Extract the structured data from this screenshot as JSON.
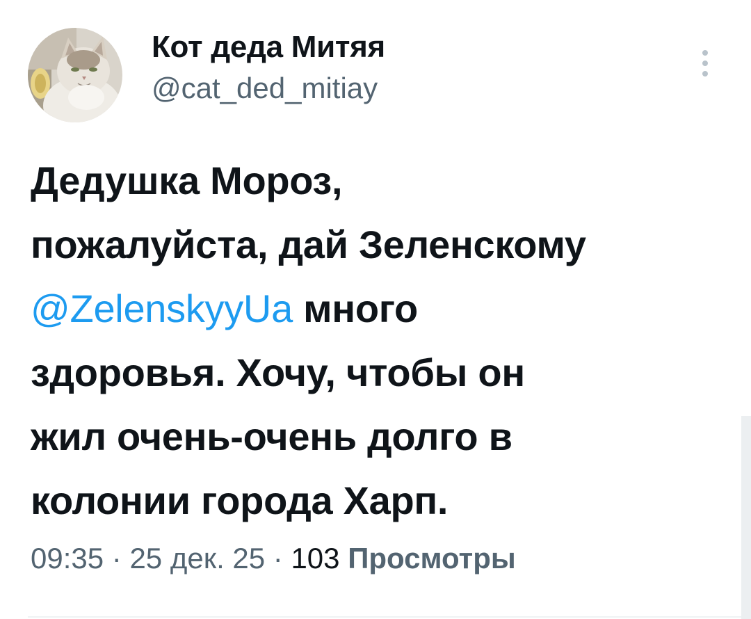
{
  "author": {
    "display_name": "Кот деда Митяя",
    "handle": "@cat_ded_mitiay"
  },
  "tweet": {
    "lines": [
      "Дедушка Мороз,",
      "пожалуйста, дай Зеленскому"
    ],
    "mention": "@ZelenskyyUa",
    "mention_suffix": " много",
    "lines_after": [
      "здоровья. Хочу, чтобы он",
      "жил очень-очень долго в",
      "колонии города Харп."
    ]
  },
  "meta": {
    "time": "09:35",
    "separator": " · ",
    "date": "25 дек. 25",
    "views_count": "103",
    "views_label": "Просмотры"
  },
  "icons": {
    "more": "more-vertical-icon",
    "avatar": "cat-avatar"
  },
  "colors": {
    "text": "#0f1419",
    "secondary": "#536471",
    "mention": "#1d9bf0"
  }
}
